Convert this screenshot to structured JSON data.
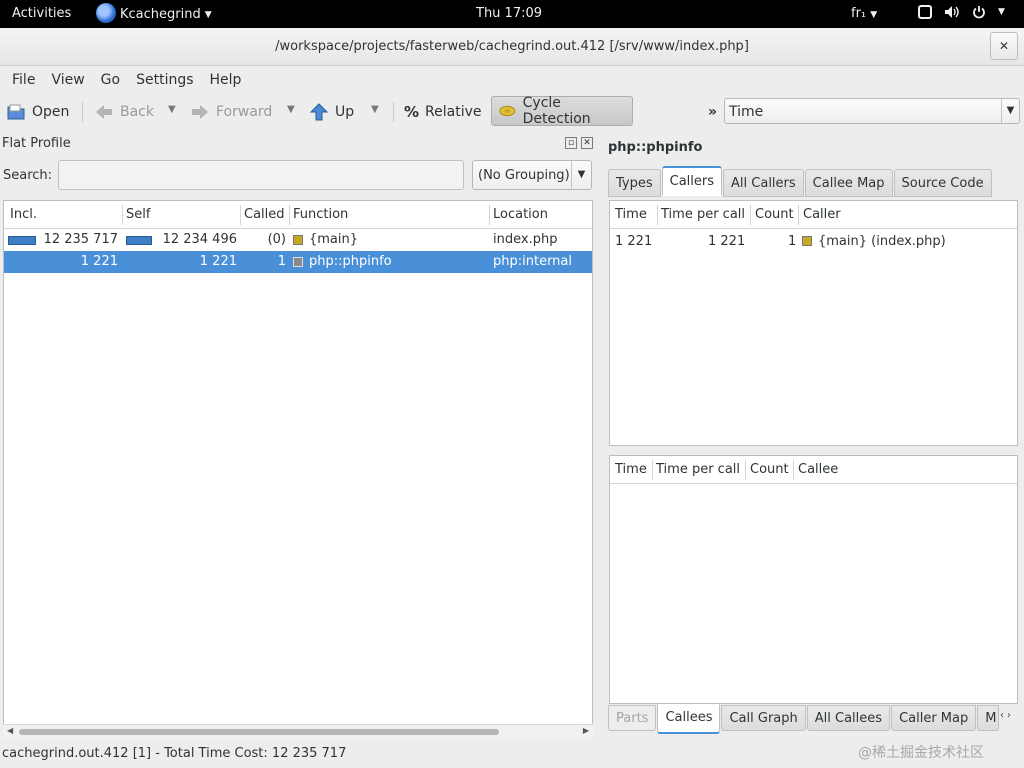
{
  "topbar": {
    "activities": "Activities",
    "app_name": "Kcachegrind",
    "clock": "Thu 17:09",
    "language": "fr₁"
  },
  "window": {
    "title": "/workspace/projects/fasterweb/cachegrind.out.412 [/srv/www/index.php]",
    "close_label": "✕"
  },
  "menu": [
    "File",
    "View",
    "Go",
    "Settings",
    "Help"
  ],
  "toolbar": {
    "open": "Open",
    "back": "Back",
    "forward": "Forward",
    "up": "Up",
    "relative": "Relative",
    "cycle": "Cycle Detection",
    "more": "»",
    "time": "Time"
  },
  "flat_profile": {
    "title": "Flat Profile",
    "search_label": "Search:",
    "search_value": "",
    "grouping": "(No Grouping)",
    "columns": [
      "Incl.",
      "Self",
      "Called",
      "Function",
      "Location"
    ],
    "rows": [
      {
        "incl": "12 235 717",
        "self": "12 234 496",
        "called": "(0)",
        "function": "{main}",
        "location": "index.php",
        "color": "#c8a820",
        "bar_fraction": 1.0,
        "selected": false
      },
      {
        "incl": "1 221",
        "self": "1 221",
        "called": "1",
        "function": "php::phpinfo",
        "location": "php:internal",
        "color": "#8a8a8a",
        "bar_fraction": 0.0,
        "selected": true
      }
    ]
  },
  "function_panel": {
    "name": "php::phpinfo",
    "top_tabs": [
      "Types",
      "Callers",
      "All Callers",
      "Callee Map",
      "Source Code"
    ],
    "top_active": "Callers",
    "callers_columns": [
      "Time",
      "Time per call",
      "Count",
      "Caller"
    ],
    "callers_rows": [
      {
        "time": "1 221",
        "per_call": "1 221",
        "count": "1",
        "caller": "{main} (index.php)",
        "color": "#c8a820"
      }
    ],
    "callees_columns": [
      "Time",
      "Time per call",
      "Count",
      "Callee"
    ],
    "bottom_tabs": [
      "Parts",
      "Callees",
      "Call Graph",
      "All Callees",
      "Caller Map",
      "M"
    ],
    "bottom_active": "Callees"
  },
  "status": "cachegrind.out.412 [1] - Total Time Cost: 12 235 717",
  "watermark": "@稀土掘金技术社区",
  "colors": {
    "accent": "#4a90d9",
    "bar": "#3d7fc7"
  }
}
